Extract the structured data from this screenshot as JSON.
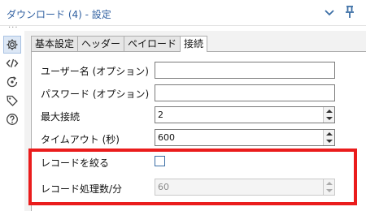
{
  "window": {
    "title": "ダウンロード (4) - 設定",
    "chevron_icon": "chevron-down-icon",
    "pin_icon": "pin-icon"
  },
  "sidebar": {
    "dots": "···",
    "items": [
      {
        "icon": "gear-icon",
        "active": true
      },
      {
        "icon": "code-icon",
        "active": false
      },
      {
        "icon": "cycle-icon",
        "active": false
      },
      {
        "icon": "tag-icon",
        "active": false
      },
      {
        "icon": "help-icon",
        "active": false
      }
    ]
  },
  "tabs": [
    {
      "label": "基本設定",
      "active": false
    },
    {
      "label": "ヘッダー",
      "active": false
    },
    {
      "label": "ペイロード",
      "active": false
    },
    {
      "label": "接続",
      "active": true
    }
  ],
  "form": {
    "username": {
      "label": "ユーザー名 (オプション)",
      "value": ""
    },
    "password": {
      "label": "パスワード (オプション)",
      "value": ""
    },
    "max_connections": {
      "label": "最大接続",
      "value": "2"
    },
    "timeout": {
      "label": "タイムアウト (秒)",
      "value": "600"
    },
    "throttle": {
      "label": "レコードを絞る",
      "checked": false
    },
    "records_per_minute": {
      "label": "レコード処理数/分",
      "value": "60",
      "disabled": true
    }
  },
  "colors": {
    "highlight": "#ea1c1c",
    "title": "#2f5fa0",
    "accent": "#3b6ea5"
  }
}
